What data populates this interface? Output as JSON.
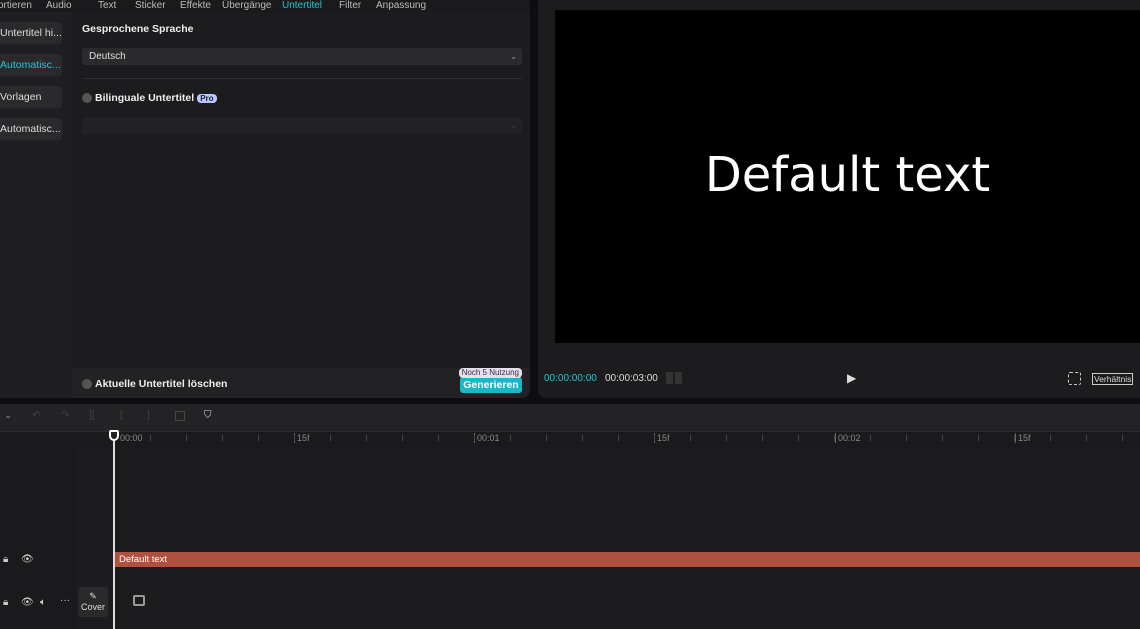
{
  "tabs": [
    {
      "label": "ortieren"
    },
    {
      "label": "Audio"
    },
    {
      "label": "Text"
    },
    {
      "label": "Sticker"
    },
    {
      "label": "Effekte"
    },
    {
      "label": "Übergänge"
    },
    {
      "label": "Untertitel",
      "active": true
    },
    {
      "label": "Filter"
    },
    {
      "label": "Anpassung"
    }
  ],
  "sidebar": {
    "items": [
      {
        "label": "Untertitel hi..."
      },
      {
        "label": "Automatisc...",
        "active": true
      },
      {
        "label": "Vorlagen"
      },
      {
        "label": "Automatisc..."
      }
    ]
  },
  "main": {
    "spoken_language_label": "Gesprochene Sprache",
    "spoken_language_value": "Deutsch",
    "bilingual_label": "Bilinguale Untertitel",
    "pro_badge": "Pro",
    "clear_label": "Aktuelle Untertitel löschen",
    "usage_badge": "Noch 5 Nutzung",
    "generate_label": "Generieren"
  },
  "preview": {
    "video_text": "Default text",
    "current_time": "00:00:00:00",
    "total_time": "00:00:03:00",
    "ratio_label": "Verhältnis"
  },
  "timeline": {
    "ruler": [
      "00:00",
      "15f",
      "00:01",
      "15f",
      "00:02",
      "15f"
    ],
    "text_clip": "Default text",
    "cover_label": "Cover"
  },
  "colors": {
    "accent": "#1ec8d4",
    "text_clip": "#b0503e"
  }
}
